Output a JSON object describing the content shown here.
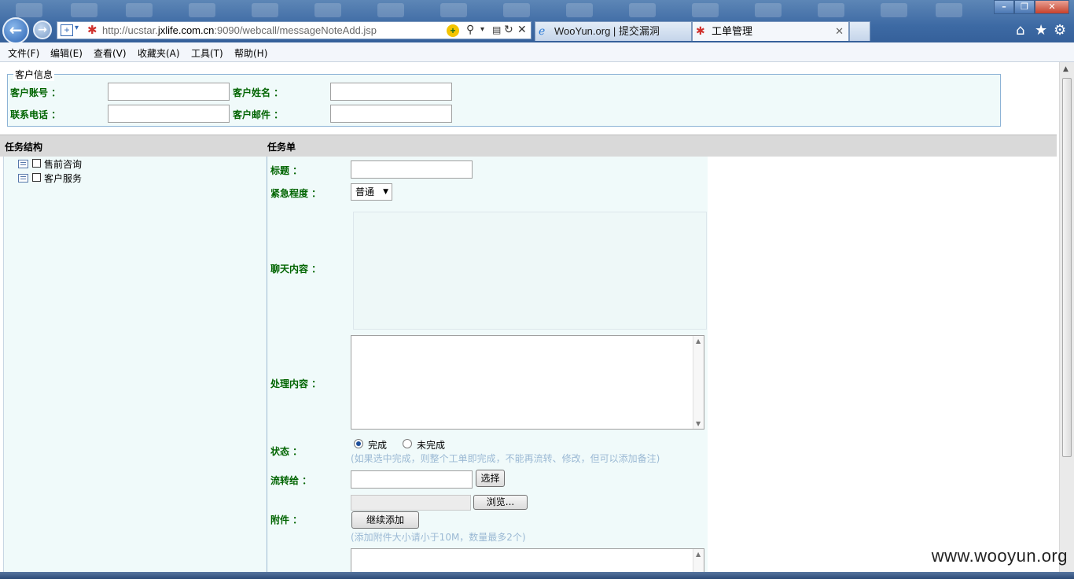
{
  "browser": {
    "url_prefix": "http://ucstar.",
    "url_domain": "jxlife.com.cn",
    "url_suffix": ":9090/webcall/messageNoteAdd.jsp",
    "tabs": [
      {
        "label": "WooYun.org | 提交漏洞",
        "active": false
      },
      {
        "label": "工单管理",
        "active": true
      }
    ]
  },
  "menu": [
    "文件(F)",
    "编辑(E)",
    "查看(V)",
    "收藏夹(A)",
    "工具(T)",
    "帮助(H)"
  ],
  "customer": {
    "legend": "客户信息",
    "account_label": "客户账号 ：",
    "name_label": "客户姓名 ：",
    "phone_label": "联系电话 ：",
    "email_label": "客户邮件 ："
  },
  "headers": {
    "left": "任务结构",
    "right": "任务单"
  },
  "tree": [
    "售前咨询",
    "客户服务"
  ],
  "form": {
    "title_label": "标题 ：",
    "urgency_label": "紧急程度 ：",
    "urgency_value": "普通",
    "chat_label": "聊天内容 ：",
    "process_label": "处理内容 ：",
    "status_label": "状态 ：",
    "status_done": "完成",
    "status_undone": "未完成",
    "status_hint": "(如果选中完成，则整个工单即完成，不能再流转、修改，但可以添加备注)",
    "transfer_label": "流转给 ：",
    "select_button": "选择",
    "browse_button": "浏览...",
    "attach_label": "附件 ：",
    "continue_add_button": "继续添加",
    "attach_hint": "(添加附件大小请小于10M，数量最多2个)"
  },
  "watermark": "www.wooyun.org"
}
